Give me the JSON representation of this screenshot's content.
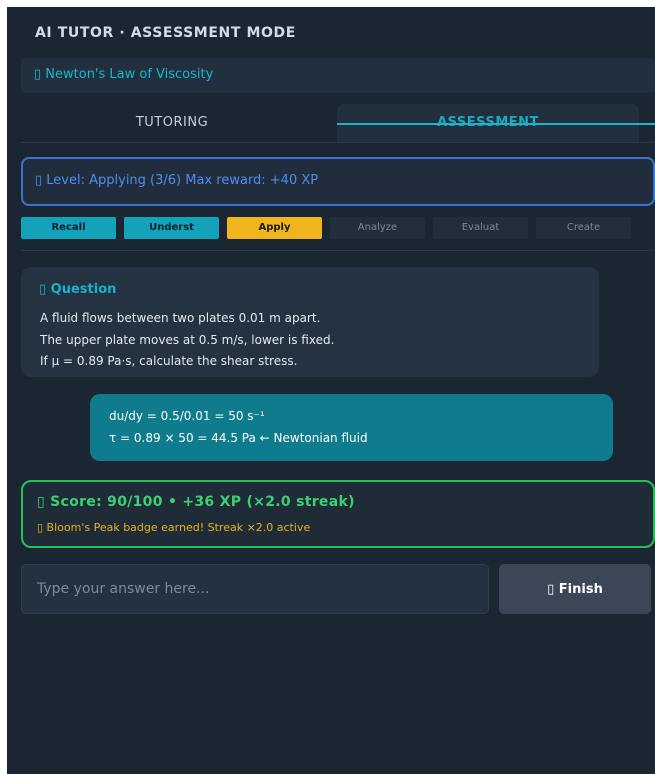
{
  "header": {
    "title": "AI TUTOR · ASSESSMENT MODE"
  },
  "topic": {
    "label": "▯ Newton's Law of Viscosity"
  },
  "tabs": [
    {
      "label": "TUTORING",
      "active": false
    },
    {
      "label": "ASSESSMENT",
      "active": true
    }
  ],
  "level": {
    "text": "▯ Level: Applying (3/6)   Max reward: +40 XP"
  },
  "bloom_levels": [
    {
      "label": "Recall",
      "state": "completed"
    },
    {
      "label": "Underst",
      "state": "completed"
    },
    {
      "label": "Apply",
      "state": "current"
    },
    {
      "label": "Analyze",
      "state": "locked"
    },
    {
      "label": "Evaluat",
      "state": "locked"
    },
    {
      "label": "Create",
      "state": "locked"
    }
  ],
  "question": {
    "label": "▯ Question",
    "lines": [
      "A fluid flows between two plates 0.01 m apart.",
      "The upper plate moves at 0.5 m/s, lower is fixed.",
      "If μ = 0.89 Pa·s, calculate the shear stress."
    ]
  },
  "answer": {
    "lines": [
      "du/dy = 0.5/0.01 = 50 s⁻¹",
      "τ = 0.89 × 50 = 44.5 Pa  ← Newtonian fluid"
    ]
  },
  "score": {
    "text": "▯ Score: 90/100  •  +36 XP  (×2.0 streak)",
    "badge": "▯ Bloom's Peak badge earned!  Streak ×2.0 active"
  },
  "input": {
    "placeholder": "Type your answer here...",
    "value": ""
  },
  "finish_button": {
    "label": "▯ Finish"
  },
  "colors": {
    "background": "#1b2633",
    "accent": "#18b6cf",
    "level_border": "#3a73cf",
    "score_green": "#3ad271",
    "badge_gold": "#e6b31e",
    "apply_yellow": "#f0b41c"
  }
}
